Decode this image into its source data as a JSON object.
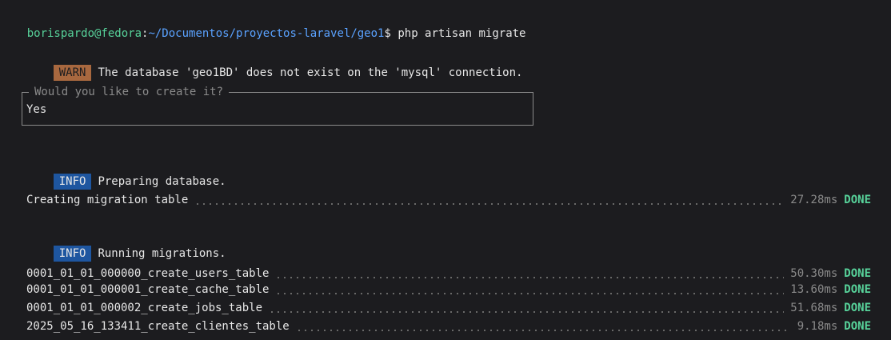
{
  "prompt": {
    "user_host": "borispardo@fedora",
    "separator": ":",
    "path": "~/Documentos/proyectos-laravel/geo1",
    "dollar": "$",
    "command": "php artisan migrate"
  },
  "warn": {
    "badge": "WARN",
    "message": "The database 'geo1BD' does not exist on the 'mysql' connection."
  },
  "confirm": {
    "question": "Would you like to create it?",
    "answer": "Yes"
  },
  "info_preparing": {
    "badge": "INFO",
    "message": "Preparing database."
  },
  "migration_table": {
    "name": "Creating migration table",
    "time": "27.28ms",
    "status": "DONE"
  },
  "info_running": {
    "badge": "INFO",
    "message": "Running migrations."
  },
  "migrations": [
    {
      "name": "0001_01_01_000000_create_users_table",
      "time": "50.30ms",
      "status": "DONE"
    },
    {
      "name": "0001_01_01_000001_create_cache_table",
      "time": "13.60ms",
      "status": "DONE"
    },
    {
      "name": "0001_01_01_000002_create_jobs_table",
      "time": "51.68ms",
      "status": "DONE"
    },
    {
      "name": "2025_05_16_133411_create_clientes_table",
      "time": "9.18ms",
      "status": "DONE"
    }
  ],
  "colors": {
    "background": "#1c1c1f",
    "prompt_user": "#57d29a",
    "prompt_path": "#5aa2ff",
    "warn_badge": "#a8683f",
    "info_badge": "#1e56a0",
    "done": "#57d29a"
  }
}
